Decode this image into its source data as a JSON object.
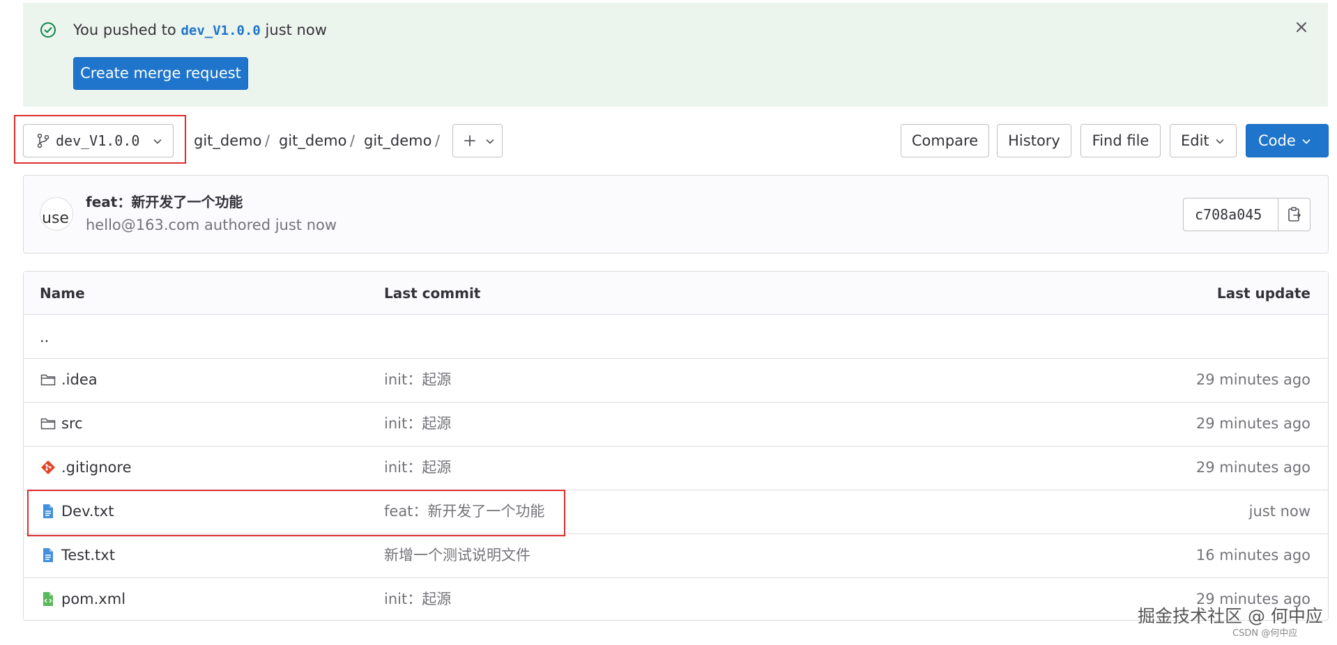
{
  "alert": {
    "prefix": "You pushed to",
    "branch": "dev_V1.0.0",
    "suffix": "just now",
    "button": "Create merge request"
  },
  "repo": {
    "branch": "dev_V1.0.0",
    "breadcrumb": [
      "git_demo",
      "git_demo",
      "git_demo"
    ],
    "separator": "/"
  },
  "toolbar": {
    "compare": "Compare",
    "history": "History",
    "find_file": "Find file",
    "edit": "Edit",
    "code": "Code"
  },
  "commit": {
    "title": "feat：新开发了一个功能",
    "meta": "hello@163.com authored just now",
    "sha": "c708a045",
    "avatar_alt": "use"
  },
  "table": {
    "headers": {
      "name": "Name",
      "last_commit": "Last commit",
      "last_update": "Last update"
    },
    "parent": "..",
    "rows": [
      {
        "icon": "folder-icon",
        "name": ".idea",
        "commit": "init：起源",
        "updated": "29 minutes ago"
      },
      {
        "icon": "folder-icon",
        "name": "src",
        "commit": "init：起源",
        "updated": "29 minutes ago"
      },
      {
        "icon": "git-icon",
        "name": ".gitignore",
        "commit": "init：起源",
        "updated": "29 minutes ago"
      },
      {
        "icon": "file-text-icon",
        "name": "Dev.txt",
        "commit": "feat：新开发了一个功能",
        "updated": "just now"
      },
      {
        "icon": "file-text-icon",
        "name": "Test.txt",
        "commit": "新增一个测试说明文件",
        "updated": "16 minutes ago"
      },
      {
        "icon": "file-xml-icon",
        "name": "pom.xml",
        "commit": "init：起源",
        "updated": "29 minutes ago"
      }
    ]
  },
  "watermark": {
    "main": "掘金技术社区 @ 何中应",
    "sub": "CSDN @何中应"
  },
  "colors": {
    "accent": "#1f75cb",
    "alert_bg": "#ecf4ee",
    "success": "#108548",
    "highlight": "#dd2b2b"
  }
}
